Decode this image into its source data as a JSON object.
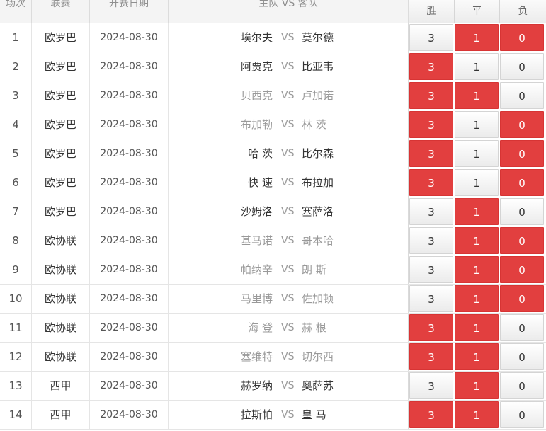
{
  "header": {
    "no": "场次",
    "league": "联赛",
    "date": "开赛日期",
    "match": "主队 VS 客队",
    "win": "胜",
    "draw": "平",
    "loss": "负"
  },
  "colors": {
    "selected": "#e23f3f",
    "unselected": "#f3f3f3"
  },
  "rows": [
    {
      "no": "1",
      "league": "欧罗巴",
      "date": "2024-08-30",
      "home": "埃尔夫",
      "vs": "VS",
      "away": "莫尔德",
      "win": "3",
      "draw": "1",
      "loss": "0",
      "sel": [
        false,
        true,
        true
      ],
      "muted": false
    },
    {
      "no": "2",
      "league": "欧罗巴",
      "date": "2024-08-30",
      "home": "阿贾克",
      "vs": "VS",
      "away": "比亚韦",
      "win": "3",
      "draw": "1",
      "loss": "0",
      "sel": [
        true,
        false,
        false
      ],
      "muted": false
    },
    {
      "no": "3",
      "league": "欧罗巴",
      "date": "2024-08-30",
      "home": "贝西克",
      "vs": "VS",
      "away": "卢加诺",
      "win": "3",
      "draw": "1",
      "loss": "0",
      "sel": [
        true,
        true,
        false
      ],
      "muted": true
    },
    {
      "no": "4",
      "league": "欧罗巴",
      "date": "2024-08-30",
      "home": "布加勒",
      "vs": "VS",
      "away": "林 茨",
      "win": "3",
      "draw": "1",
      "loss": "0",
      "sel": [
        true,
        false,
        true
      ],
      "muted": true
    },
    {
      "no": "5",
      "league": "欧罗巴",
      "date": "2024-08-30",
      "home": "哈 茨",
      "vs": "VS",
      "away": "比尔森",
      "win": "3",
      "draw": "1",
      "loss": "0",
      "sel": [
        true,
        false,
        true
      ],
      "muted": false
    },
    {
      "no": "6",
      "league": "欧罗巴",
      "date": "2024-08-30",
      "home": "快 速",
      "vs": "VS",
      "away": "布拉加",
      "win": "3",
      "draw": "1",
      "loss": "0",
      "sel": [
        true,
        false,
        true
      ],
      "muted": false
    },
    {
      "no": "7",
      "league": "欧罗巴",
      "date": "2024-08-30",
      "home": "沙姆洛",
      "vs": "VS",
      "away": "塞萨洛",
      "win": "3",
      "draw": "1",
      "loss": "0",
      "sel": [
        false,
        true,
        false
      ],
      "muted": false
    },
    {
      "no": "8",
      "league": "欧协联",
      "date": "2024-08-30",
      "home": "基马诺",
      "vs": "VS",
      "away": "哥本哈",
      "win": "3",
      "draw": "1",
      "loss": "0",
      "sel": [
        false,
        true,
        true
      ],
      "muted": true
    },
    {
      "no": "9",
      "league": "欧协联",
      "date": "2024-08-30",
      "home": "帕纳辛",
      "vs": "VS",
      "away": "朗 斯",
      "win": "3",
      "draw": "1",
      "loss": "0",
      "sel": [
        false,
        true,
        true
      ],
      "muted": true
    },
    {
      "no": "10",
      "league": "欧协联",
      "date": "2024-08-30",
      "home": "马里博",
      "vs": "VS",
      "away": "佐加顿",
      "win": "3",
      "draw": "1",
      "loss": "0",
      "sel": [
        false,
        true,
        true
      ],
      "muted": true
    },
    {
      "no": "11",
      "league": "欧协联",
      "date": "2024-08-30",
      "home": "海 登",
      "vs": "VS",
      "away": "赫 根",
      "win": "3",
      "draw": "1",
      "loss": "0",
      "sel": [
        true,
        true,
        false
      ],
      "muted": true
    },
    {
      "no": "12",
      "league": "欧协联",
      "date": "2024-08-30",
      "home": "塞维特",
      "vs": "VS",
      "away": "切尔西",
      "win": "3",
      "draw": "1",
      "loss": "0",
      "sel": [
        true,
        true,
        false
      ],
      "muted": true
    },
    {
      "no": "13",
      "league": "西甲",
      "date": "2024-08-30",
      "home": "赫罗纳",
      "vs": "VS",
      "away": "奥萨苏",
      "win": "3",
      "draw": "1",
      "loss": "0",
      "sel": [
        false,
        true,
        false
      ],
      "muted": false
    },
    {
      "no": "14",
      "league": "西甲",
      "date": "2024-08-30",
      "home": "拉斯帕",
      "vs": "VS",
      "away": "皇 马",
      "win": "3",
      "draw": "1",
      "loss": "0",
      "sel": [
        true,
        true,
        false
      ],
      "muted": false
    }
  ]
}
